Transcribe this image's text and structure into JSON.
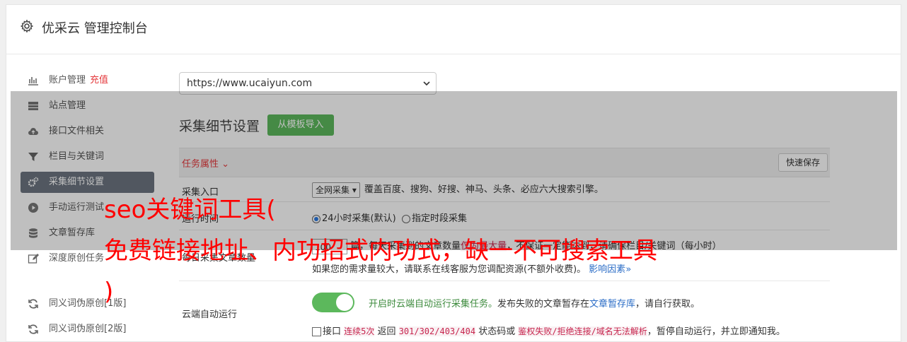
{
  "header": {
    "title": "优采云 管理控制台",
    "icon": "gear-icon"
  },
  "sidebar": {
    "items": [
      {
        "label": "账户管理",
        "extra": "充值",
        "icon": "bar-chart-icon"
      },
      {
        "label": "站点管理",
        "icon": "server-icon"
      },
      {
        "label": "接口文件相关",
        "icon": "cloud-upload-icon"
      },
      {
        "label": "栏目与关键词",
        "icon": "filter-icon"
      },
      {
        "label": "采集细节设置",
        "icon": "cogs-icon",
        "active": true
      },
      {
        "label": "手动运行测试",
        "icon": "play-circle-icon"
      },
      {
        "label": "文章暂存库",
        "icon": "database-icon"
      },
      {
        "label": "深度原创任务",
        "icon": "edit-icon"
      },
      {
        "label": "同义词伪原创[1版]",
        "icon": "refresh-icon"
      },
      {
        "label": "同义词伪原创[2版]",
        "icon": "refresh-icon"
      }
    ]
  },
  "main": {
    "site_select": "https://www.ucaiyun.com",
    "section_title": "采集细节设置",
    "import_button": "从模板导入",
    "task_attr_label": "任务属性",
    "save_button": "快速保存",
    "entry": {
      "label": "采集入口",
      "select_value": "全网采集",
      "desc": "覆盖百度、搜狗、好搜、神马、头条、必应六大搜索引擎。"
    },
    "time": {
      "label": "运行时间",
      "opt1": "24小时采集(默认)",
      "opt2": "指定时段采集"
    },
    "count": {
      "label": "每日采集文章数量",
      "value": "100",
      "desc_a": "篇，每天采集到的文章数量",
      "desc_hl": "仅为最大量",
      "desc_b": "，不保证一定能达到，请确保栏目/关键词",
      "desc_c": "（每小时）",
      "line2": "如果您的需求量较大，请联系在线客服为您调配资源(不额外收费)。",
      "link": "影响因素"
    },
    "cloud": {
      "label": "云端自动运行",
      "toggle_on": true,
      "line1_green": "开启时云端自动运行采集任务。",
      "line1_a": "发布失败的文章暂存在",
      "line1_link": "文章暂存库",
      "line1_b": "，请自行获取。",
      "line2_a": "接口",
      "line2_hl1": "连续5次",
      "line2_b": "返回",
      "line2_code1": "301/302/403/404",
      "line2_c": "状态码或",
      "line2_code2": "鉴权失败/拒绝连接/域名无法解析",
      "line2_d": "，暂停自动运行，并立即通知我。"
    }
  },
  "watermark": {
    "line1": "seo关键词工具(",
    "line2": "免费链接地址、内功招式内功式，缺一不可搜索工具",
    "line3": ")"
  }
}
